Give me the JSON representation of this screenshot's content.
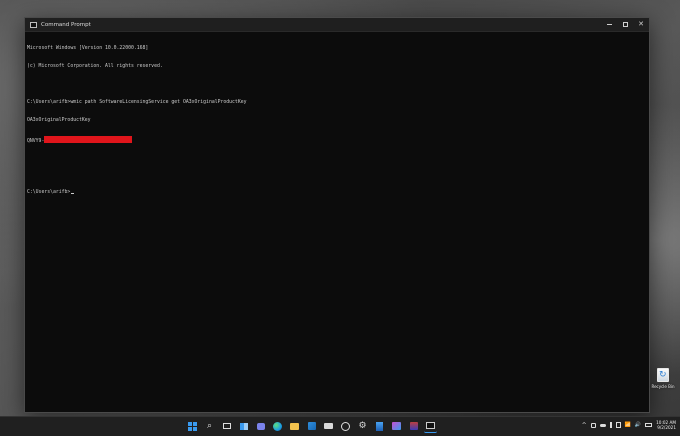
{
  "window": {
    "title": "Command Prompt",
    "controls": {
      "minimize": "minimize-icon",
      "maximize": "maximize-icon",
      "close": "close-icon"
    }
  },
  "console": {
    "line1": "Microsoft Windows [Version 10.0.22000.168]",
    "line2": "(c) Microsoft Corporation. All rights reserved.",
    "line3": "C:\\Users\\arifb>wmic path SoftwareLicensingService get OA3xOriginalProductKey",
    "line4": "OA3xOriginalProductKey",
    "line5_prefix": "QNVY9-",
    "prompt": "C:\\Users\\arifb>"
  },
  "desktop": {
    "recycle_bin_label": "Recycle Bin"
  },
  "taskbar": {
    "icons": [
      "start-icon",
      "search-icon",
      "task-view-icon",
      "widgets-icon",
      "chat-icon",
      "edge-icon",
      "file-explorer-icon",
      "store-icon",
      "mail-icon",
      "dell-icon",
      "settings-icon",
      "app-icon",
      "terminal-icon",
      "cmd-icon"
    ],
    "tray_chevron": "^",
    "time": "10:02 AM",
    "date": "9/2/2021"
  },
  "colors": {
    "accent": "#3a9bf0",
    "redaction": "#e0151b",
    "console_bg": "#0c0c0c"
  }
}
